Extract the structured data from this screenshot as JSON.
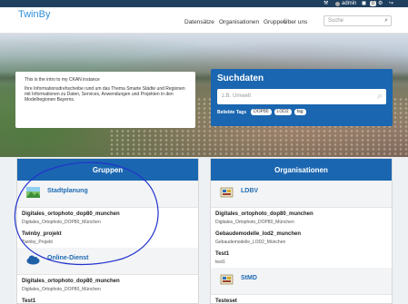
{
  "account": {
    "user": "admin",
    "count": "0"
  },
  "header": {
    "logo": "TwinBy",
    "nav": [
      "Datensätze",
      "Organisationen",
      "Gruppen",
      "Über uns"
    ],
    "search_placeholder": "Suche"
  },
  "hero": {
    "intro_line": "This is the intro to my CKAN instance",
    "intro_text": "Ihre Informationsdrehscheibe rund um das Thema Smarte Städte und Regionen mit Informationen zu Daten, Services, Anwendungen und Projekten in den Modellregionen Bayerns."
  },
  "search_panel": {
    "title": "Suchdaten",
    "placeholder": "z.B. Umwelt",
    "tags_label": "Beliebte Tags",
    "tags": [
      "DOP80",
      "LOD2",
      "tag"
    ]
  },
  "groups": {
    "title": "Gruppen",
    "entities": [
      {
        "name": "Stadtplanung",
        "icon": "landscape-icon",
        "datasets": [
          {
            "title": "Digitales_ortophoto_dop80_munchen",
            "sub": "Digitales_Ortophoto_DOP80_München"
          },
          {
            "title": "Twinby_projekt",
            "sub": "Twinby_Projekt"
          }
        ]
      },
      {
        "name": "Online-Dienst",
        "icon": "cloud-icon",
        "datasets": [
          {
            "title": "Digitales_ortophoto_dop80_munchen",
            "sub": "Digitales_Ortophoto_DOP80_München"
          },
          {
            "title": "Test1",
            "sub": ""
          }
        ]
      }
    ]
  },
  "organizations": {
    "title": "Organisationen",
    "entities": [
      {
        "name": "LDBV",
        "icon": "bavarian-crest-icon",
        "datasets": [
          {
            "title": "Digitales_ortophoto_dop80_munchen",
            "sub": "Digitales_Ortophoto_DOP80_München"
          },
          {
            "title": "Gebaudemodelle_lod2_munchen",
            "sub": "Gebaudemodelle_LOD2_München"
          },
          {
            "title": "Test1",
            "sub": "test1"
          }
        ]
      },
      {
        "name": "StMD",
        "icon": "bavarian-crest-icon",
        "datasets": [
          {
            "title": "Testeset",
            "sub": ""
          }
        ]
      }
    ]
  },
  "colors": {
    "primary": "#1a66b0",
    "account_bar": "#1f3f5f",
    "link": "#1f6bb0",
    "annotation": "#2233cc"
  }
}
